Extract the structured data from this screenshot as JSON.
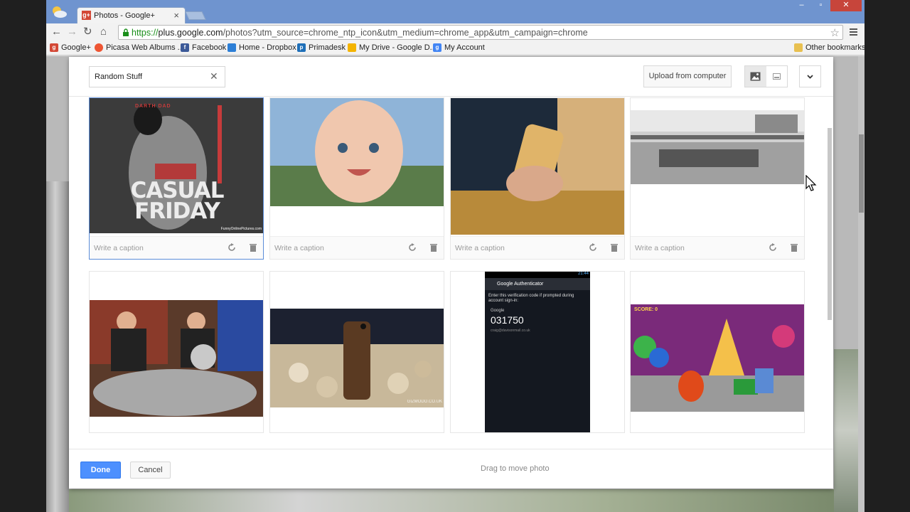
{
  "browser": {
    "tab_title": "Photos - Google+",
    "tab_favicon": "g+",
    "url_scheme": "https://",
    "url_host": "plus.google.com",
    "url_rest": "/photos?utm_source=chrome_ntp_icon&utm_medium=chrome_app&utm_campaign=chrome",
    "bookmarks": [
      "Google+",
      "Picasa Web Albums ...",
      "Facebook",
      "Home - Dropbox",
      "Primadesk",
      "My Drive - Google D...",
      "My Account"
    ],
    "other_bookmarks": "Other bookmarks"
  },
  "dialog": {
    "album_name": "Random Stuff",
    "upload_label": "Upload from computer",
    "photos": [
      {
        "caption_placeholder": "Write a caption",
        "img_title_top": "DARTH DAD",
        "img_text": "CASUAL FRIDAY",
        "img_credit": "FunnyOnlinePictures.com"
      },
      {
        "caption_placeholder": "Write a caption"
      },
      {
        "caption_placeholder": "Write a caption"
      },
      {
        "caption_placeholder": "Write a caption"
      },
      {},
      {
        "img_credit": "GIZMODO.CO.UK"
      },
      {
        "app_title": "Google Authenticator",
        "app_desc": "Enter this verification code if prompted during account sign-in:",
        "account_label": "Google",
        "code": "031750",
        "email": "craig@davisonmail.co.uk",
        "status_time": "21:44"
      },
      {
        "score_label": "SCORE: 0"
      }
    ],
    "done_label": "Done",
    "cancel_label": "Cancel",
    "hint": "Drag to move photo"
  },
  "colors": {
    "accent": "#4d90fe",
    "titlebar": "#6f94cf",
    "selected_border": "#5b8dd9"
  }
}
